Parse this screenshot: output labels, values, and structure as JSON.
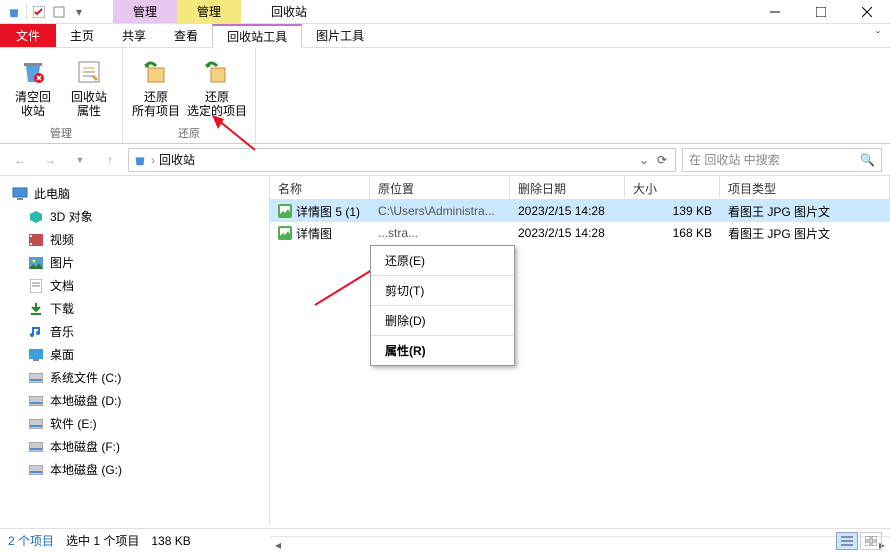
{
  "title": "回收站",
  "contextTabs": {
    "purple": "管理",
    "yellow": "管理"
  },
  "menuTabs": {
    "file": "文件",
    "home": "主页",
    "share": "共享",
    "view": "查看",
    "toolsRecycle": "回收站工具",
    "toolsPicture": "图片工具"
  },
  "ribbon": {
    "emptyBin": "清空回\n收站",
    "binProps": "回收站\n属性",
    "restoreAll": "还原\n所有项目",
    "restoreSel": "还原\n选定的项目",
    "groupManage": "管理",
    "groupRestore": "还原"
  },
  "breadcrumb": {
    "location": "回收站"
  },
  "search": {
    "placeholder": "在 回收站 中搜索"
  },
  "columns": {
    "name": "名称",
    "loc": "原位置",
    "date": "删除日期",
    "size": "大小",
    "type": "项目类型"
  },
  "rows": [
    {
      "name": "详情图  5 (1)",
      "loc": "C:\\Users\\Administra...",
      "date": "2023/2/15 14:28",
      "size": "139 KB",
      "type": "看图王 JPG 图片文"
    },
    {
      "name": "详情图",
      "loc": "...stra...",
      "date": "2023/2/15 14:28",
      "size": "168 KB",
      "type": "看图王 JPG 图片文"
    }
  ],
  "contextMenu": {
    "restore": "还原(E)",
    "cut": "剪切(T)",
    "delete": "删除(D)",
    "properties": "属性(R)"
  },
  "sidebar": {
    "thisPC": "此电脑",
    "items": [
      "3D 对象",
      "视频",
      "图片",
      "文档",
      "下载",
      "音乐",
      "桌面",
      "系统文件 (C:)",
      "本地磁盘 (D:)",
      "软件 (E:)",
      "本地磁盘 (F:)",
      "本地磁盘 (G:)"
    ]
  },
  "status": {
    "count": "2 个项目",
    "selected": "选中 1 个项目",
    "size": "138 KB"
  },
  "colors": {
    "accent": "#e81123",
    "selection": "#cce8ff"
  }
}
